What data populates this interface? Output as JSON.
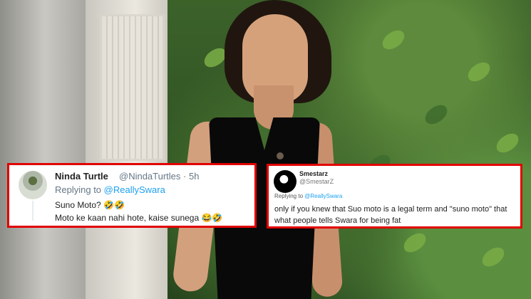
{
  "tweets": {
    "left": {
      "name": "Ninda Turtle",
      "handle": "@NindaTurtles · 5h",
      "replying_to_prefix": "Replying to",
      "replying_to_handle": "@ReallySwara",
      "text": "Suno Moto? 🤣🤣\nMoto ke kaan nahi hote, kaise sunega 😂🤣"
    },
    "right": {
      "name": "Smestarz",
      "handle": "@SmestarZ",
      "replying_to_prefix": "Replying to",
      "replying_to_handle": "@ReallySwara",
      "text": "only if you knew that Suo moto is a legal term and \"suno moto\" that what people tells Swara for being fat"
    }
  },
  "colors": {
    "highlight_border": "#e10000",
    "twitter_link": "#1da1f2",
    "text": "#222222"
  },
  "icons": {
    "left_avatar": "avatar-icon",
    "right_avatar": "feather-avatar-icon"
  }
}
